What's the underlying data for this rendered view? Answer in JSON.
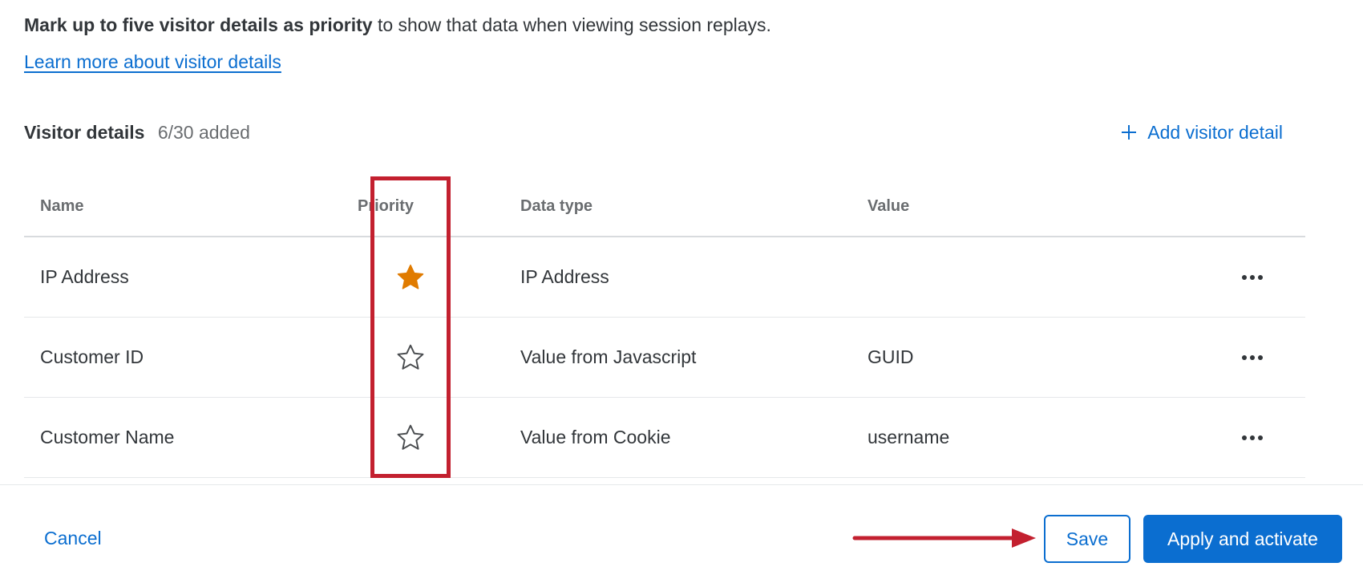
{
  "intro": {
    "bold_text": "Mark up to five visitor details as priority",
    "rest_text": " to show that data when viewing session replays."
  },
  "learn_more_link": "Learn more about visitor details",
  "section": {
    "title": "Visitor details",
    "count": "6/30 added",
    "add_label": "Add visitor detail"
  },
  "table": {
    "columns": [
      "Name",
      "Priority",
      "Data type",
      "Value"
    ],
    "rows": [
      {
        "name": "IP Address",
        "priority": true,
        "data_type": "IP Address",
        "value": ""
      },
      {
        "name": "Customer ID",
        "priority": false,
        "data_type": "Value from Javascript",
        "value": "GUID"
      },
      {
        "name": "Customer Name",
        "priority": false,
        "data_type": "Value from Cookie",
        "value": "username"
      }
    ]
  },
  "footer": {
    "cancel_label": "Cancel",
    "save_label": "Save",
    "apply_label": "Apply and activate"
  },
  "colors": {
    "accent": "#0b6ed0",
    "priority_star": "#e07b00",
    "annotation": "#c3202f"
  },
  "icons": {
    "add": "plus-icon",
    "priority_on": "star-filled-icon",
    "priority_off": "star-outline-icon",
    "row_menu": "more-horizontal-icon"
  }
}
